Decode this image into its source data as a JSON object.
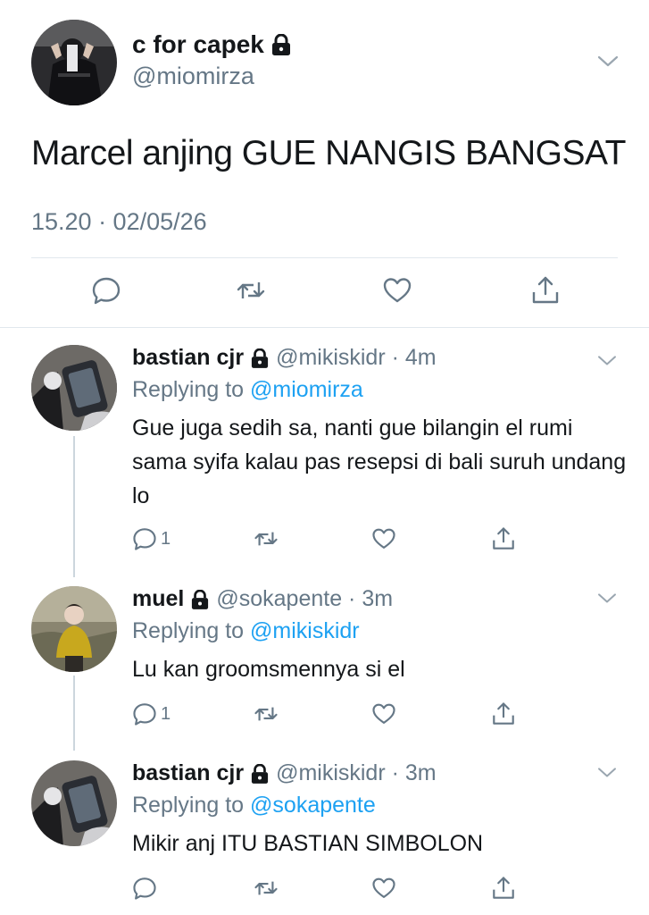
{
  "main_tweet": {
    "display_name": "c for capek",
    "handle": "@miomirza",
    "text": "Marcel anjing GUE NANGIS BANGSAT",
    "timestamp": "15.20 · 02/05/26",
    "icons": {
      "lock": "lock-icon",
      "menu": "chevron-down-icon",
      "reply": "reply-icon",
      "retweet": "retweet-icon",
      "like": "heart-icon",
      "share": "share-icon"
    }
  },
  "replies": [
    {
      "display_name": "bastian cjr",
      "handle_time": "@mikiskidr · 4m",
      "replying_prefix": "Replying to",
      "replying_to": "@miomirza",
      "text": "Gue juga sedih sa, nanti gue bilangin el rumi sama syifa kalau pas resepsi di bali suruh undang lo",
      "reply_count": "1"
    },
    {
      "display_name": "muel",
      "handle_time": "@sokapente · 3m",
      "replying_prefix": "Replying to",
      "replying_to": "@mikiskidr",
      "text": "Lu kan groomsmennya si el",
      "reply_count": "1"
    },
    {
      "display_name": "bastian cjr",
      "handle_time": "@mikiskidr · 3m",
      "replying_prefix": "Replying to",
      "replying_to": "@sokapente",
      "text": "Mikir anj ITU BASTIAN SIMBOLON",
      "reply_count": ""
    }
  ],
  "colors": {
    "text": "#14171a",
    "secondary": "#657786",
    "link": "#1da1f2",
    "divider": "#e1e8ed",
    "thread_line": "#ccd6dd"
  }
}
